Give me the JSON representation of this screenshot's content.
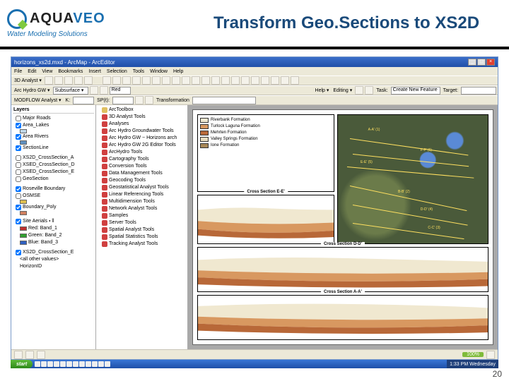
{
  "slide": {
    "title": "Transform Geo.Sections to XS2D",
    "number": "20"
  },
  "brand": {
    "name_a": "AQUA",
    "name_b": "VEO",
    "tagline": "Water Modeling Solutions"
  },
  "window": {
    "title": "horizons_xs2d.mxd - ArcMap - ArcEditor"
  },
  "menu": [
    "File",
    "Edit",
    "View",
    "Bookmarks",
    "Insert",
    "Selection",
    "Tools",
    "Window",
    "Help"
  ],
  "toolbars": {
    "a_label": "3D Analyst ▾",
    "b1_label": "Arc Hydro GW ▾",
    "b1_sel": "Subsurface ▾",
    "b1_field": "Red",
    "b2_label": "MODFLOW Analyst ▾",
    "b2_k": "K:",
    "b2_sp": "SP(t):",
    "b2_tx": "Transformation",
    "help": "Help ▾",
    "editing": "Editing ▾",
    "task": "Task:",
    "task_val": "Create New Feature",
    "target": "Target:"
  },
  "toc": {
    "header": "Layers",
    "groups": [
      {
        "name": "Major Roads",
        "on": false
      },
      {
        "name": "Area_Lakes",
        "on": true
      },
      {
        "name": "Area Rivers",
        "on": true
      },
      {
        "name": "SectionLine",
        "on": true
      }
    ],
    "xs_group": [
      {
        "name": "XS2D_CrossSection_A",
        "on": false
      },
      {
        "name": "XSED_CrossSection_D",
        "on": false
      },
      {
        "name": "XSED_CrossSection_E",
        "on": false
      },
      {
        "name": "GeoSection",
        "on": false
      }
    ],
    "misc": [
      {
        "name": "Roseville Boundary",
        "on": true
      },
      {
        "name": "OSMSE",
        "on": false,
        "sw": "#e0c050"
      },
      {
        "name": "Boundary_Poly",
        "on": true,
        "sw": "#d08060"
      }
    ],
    "site": {
      "name": "Site Aerials ⬩ ll",
      "bands": [
        {
          "label": "Red: Band_1",
          "color": "#c03030"
        },
        {
          "label": "Green: Band_2",
          "color": "#30a030"
        },
        {
          "label": "Blue: Band_3",
          "color": "#3060c0"
        }
      ]
    },
    "bottom_grp": "XS2D_CrossSection_E",
    "bottom_items": [
      "<all other values>",
      "HorizonID"
    ]
  },
  "toolbox": {
    "root": "ArcToolbox",
    "items": [
      "3D Analyst Tools",
      "Analyses",
      "Arc Hydro Groundwater Tools",
      "Arc Hydro GW − Horizons arch",
      "Arc Hydro GW 2G Editor Tools",
      "ArcHydro Tools",
      "Cartography Tools",
      "Conversion Tools",
      "Data Management Tools",
      "Geocoding Tools",
      "Geostatistical Analyst Tools",
      "Linear Referencing Tools",
      "Multidimension Tools",
      "Network Analyst Tools",
      "Samples",
      "Server Tools",
      "Spatial Analyst Tools",
      "Spatial Statistics Tools",
      "Tracking Analyst Tools"
    ]
  },
  "legend": {
    "items": [
      {
        "label": "Riverbank Formation",
        "color": "#f0e8d0"
      },
      {
        "label": "Turlock Laguna Formation",
        "color": "#d89860"
      },
      {
        "label": "Mehrten Formation",
        "color": "#b86838"
      },
      {
        "label": "Valley Springs Formation",
        "color": "#e8dcc0"
      },
      {
        "label": "Ione Formation",
        "color": "#a88858"
      }
    ]
  },
  "map_lines": [
    {
      "label": "A-A' (1)"
    },
    {
      "label": "F-F' (6)"
    },
    {
      "label": "E-E' (5)"
    },
    {
      "label": "B-B' (2)"
    },
    {
      "label": "D-D' (4)"
    },
    {
      "label": "C-C' (3)"
    }
  ],
  "sections": {
    "ee": "Cross Section E-E'",
    "dd": "Cross Section D-D'",
    "aa": "Cross Section A-A'"
  },
  "status": {
    "scale": "100%"
  },
  "taskbar": {
    "start": "start",
    "time": "1:33 PM",
    "day": "Wednesday"
  }
}
